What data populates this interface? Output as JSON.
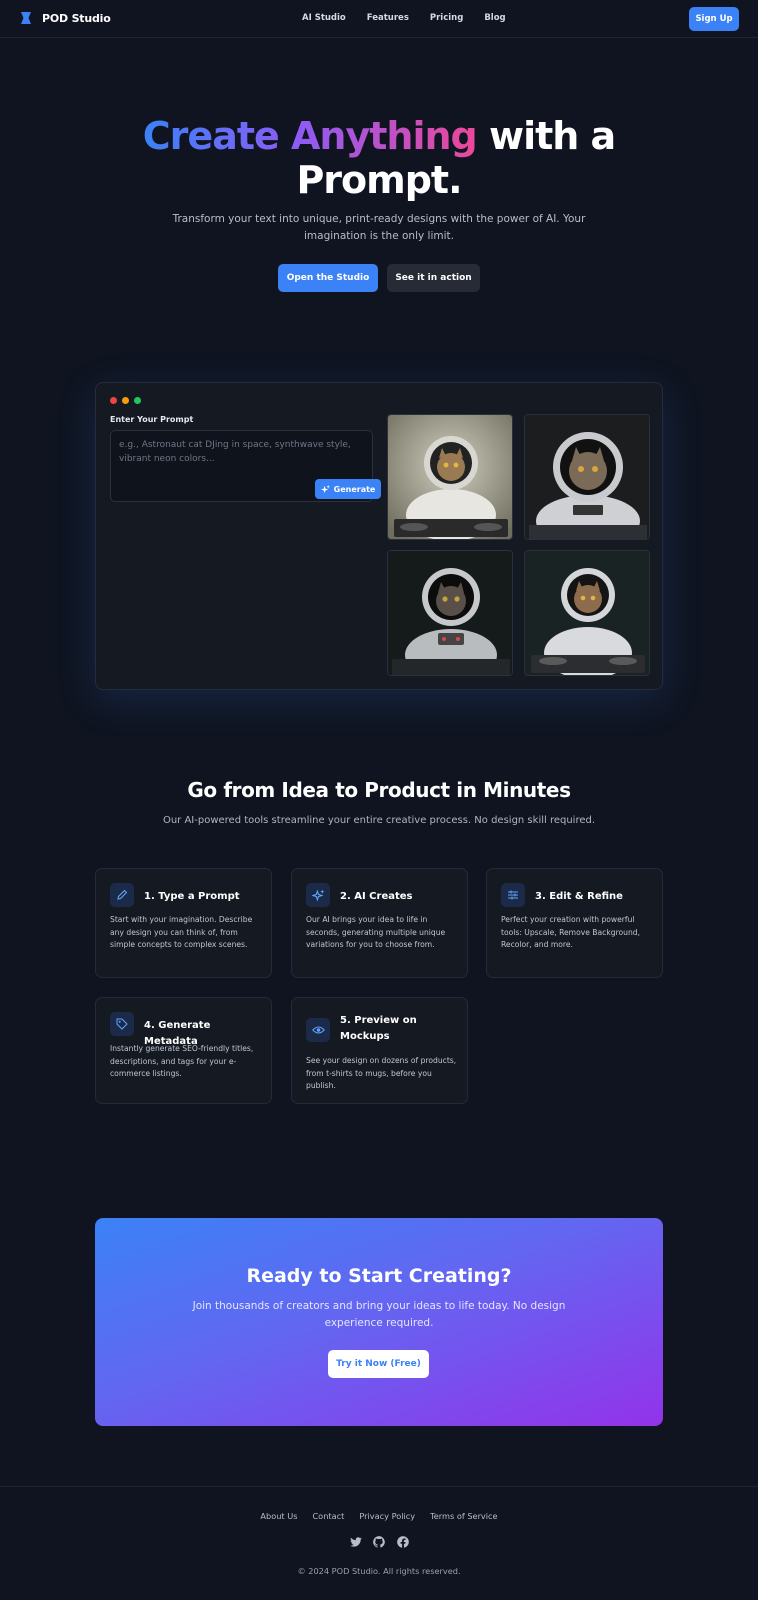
{
  "nav": {
    "brand": "POD Studio",
    "links": [
      "AI Studio",
      "Features",
      "Pricing",
      "Blog"
    ],
    "signup": "Sign Up"
  },
  "hero": {
    "title_gradient": "Create Anything",
    "title_rest_line1": " with a",
    "title_line2": "Prompt.",
    "subtitle": "Transform your text into unique, print-ready designs with the power of AI. Your imagination is the only limit.",
    "primary_button": "Open the Studio",
    "secondary_button": "See it in action"
  },
  "demo": {
    "prompt_label": "Enter Your Prompt",
    "prompt_placeholder": "e.g., Astronaut cat DJing in space, synthwave style, vibrant neon colors...",
    "generate_button": "Generate"
  },
  "features": {
    "title": "Go from Idea to Product in Minutes",
    "subtitle": "Our AI-powered tools streamline your entire creative process. No design skill required.",
    "cards": [
      {
        "title": "1. Type a Prompt",
        "description": "Start with your imagination. Describe any design you can think of, from simple concepts to complex scenes.",
        "icon": "pencil-icon"
      },
      {
        "title": "2. AI Creates",
        "description": "Our AI brings your idea to life in seconds, generating multiple unique variations for you to choose from.",
        "icon": "sparkles-icon"
      },
      {
        "title": "3. Edit & Refine",
        "description": "Perfect your creation with powerful tools: Upscale, Remove Background, Recolor, and more.",
        "icon": "sliders-icon"
      },
      {
        "title": "4. Generate Metadata",
        "description": "Instantly generate SEO-friendly titles, descriptions, and tags for your e-commerce listings.",
        "icon": "tag-icon"
      },
      {
        "title": "5. Preview on Mockups",
        "description": "See your design on dozens of products, from t-shirts to mugs, before you publish.",
        "icon": "eye-icon"
      }
    ]
  },
  "cta": {
    "title": "Ready to Start Creating?",
    "subtitle": "Join thousands of creators and bring your ideas to life today. No design experience required.",
    "button": "Try it Now (Free)"
  },
  "footer": {
    "links": [
      "About Us",
      "Contact",
      "Privacy Policy",
      "Terms of Service"
    ],
    "social": [
      "twitter-icon",
      "github-icon",
      "facebook-icon"
    ],
    "copyright": "© 2024 POD Studio. All rights reserved."
  },
  "colors": {
    "background": "#0f1420",
    "accent": "#3b82f6",
    "gradient_start": "#3b82f6",
    "gradient_mid": "#8b5cf6",
    "gradient_end": "#ec4899"
  }
}
